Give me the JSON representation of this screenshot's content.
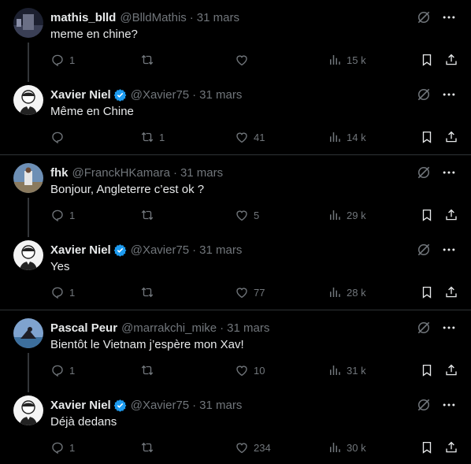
{
  "threads": [
    {
      "reply": {
        "name": "mathis_blld",
        "verified": false,
        "handle": "@BlldMathis",
        "date": "31 mars",
        "text": "meme en chine?",
        "replies": "1",
        "reposts": "",
        "likes": "",
        "views": "15 k"
      },
      "answer": {
        "name": "Xavier Niel",
        "verified": true,
        "handle": "@Xavier75",
        "date": "31 mars",
        "text": "Même en Chine",
        "replies": "",
        "reposts": "1",
        "likes": "41",
        "views": "14 k"
      }
    },
    {
      "reply": {
        "name": "fhk",
        "verified": false,
        "handle": "@FranckHKamara",
        "date": "31 mars",
        "text": "Bonjour, Angleterre c’est ok ?",
        "replies": "1",
        "reposts": "",
        "likes": "5",
        "views": "29 k"
      },
      "answer": {
        "name": "Xavier Niel",
        "verified": true,
        "handle": "@Xavier75",
        "date": "31 mars",
        "text": "Yes",
        "replies": "1",
        "reposts": "",
        "likes": "77",
        "views": "28 k"
      }
    },
    {
      "reply": {
        "name": "Pascal Peur",
        "verified": false,
        "handle": "@marrakchi_mike",
        "date": "31 mars",
        "text": "Bientôt le Vietnam j’espère mon Xav!",
        "replies": "1",
        "reposts": "",
        "likes": "10",
        "views": "31 k"
      },
      "answer": {
        "name": "Xavier Niel",
        "verified": true,
        "handle": "@Xavier75",
        "date": "31 mars",
        "text": "Déjà dedans",
        "replies": "1",
        "reposts": "",
        "likes": "234",
        "views": "30 k"
      }
    }
  ],
  "colors": {
    "background": "#000000",
    "text": "#e7e9ea",
    "muted": "#71767b",
    "verified": "#1d9bf0",
    "divider": "#2f3336"
  },
  "icons": [
    "reply-icon",
    "repost-icon",
    "like-icon",
    "views-icon",
    "bookmark-icon",
    "share-icon",
    "grok-icon",
    "more-icon",
    "verified-badge-icon"
  ]
}
